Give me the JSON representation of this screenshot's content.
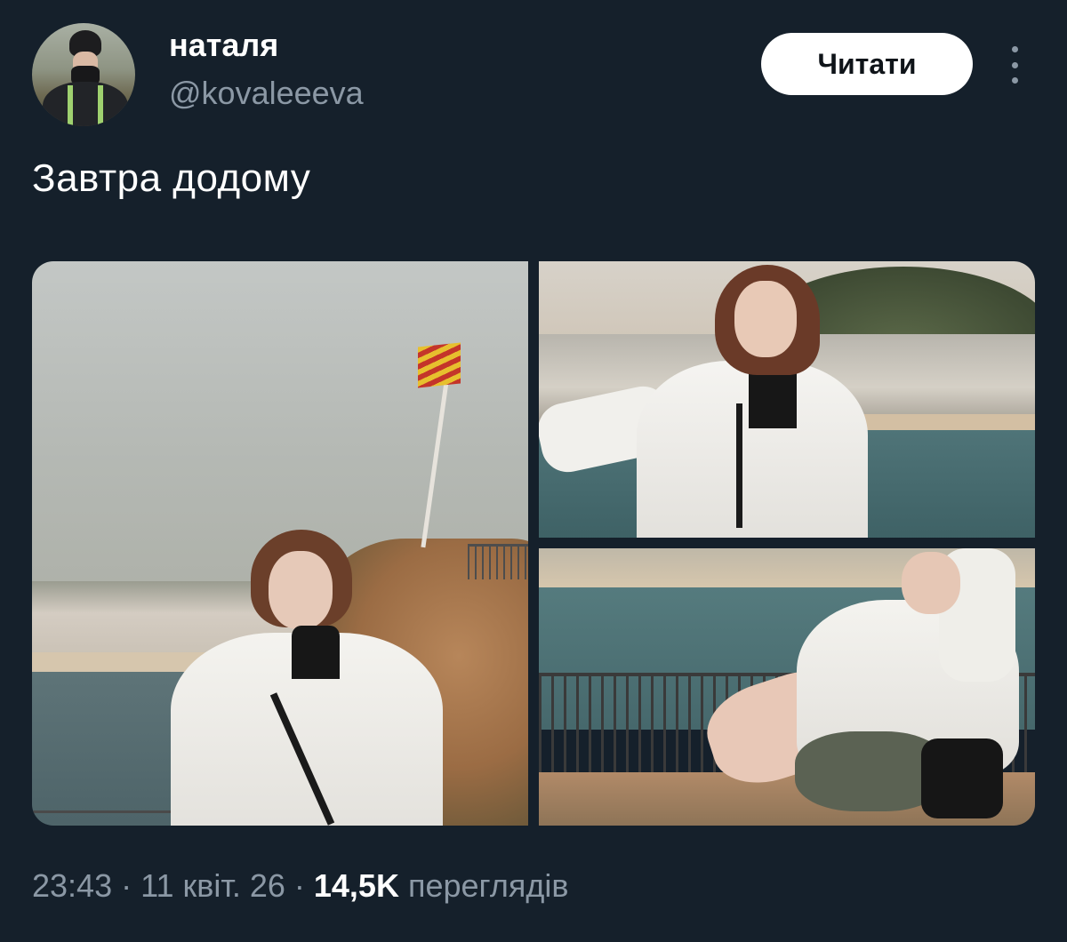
{
  "author": {
    "display_name": "наталя",
    "handle": "@kovaleeeva"
  },
  "actions": {
    "follow_label": "Читати",
    "more_icon": "more-vertical-icon"
  },
  "tweet": {
    "text": "Завтра додому",
    "media_count": 3
  },
  "meta": {
    "time": "23:43",
    "separator": " · ",
    "date": "11 квіт. 26",
    "views_count": "14,5K",
    "views_label": " переглядів"
  },
  "colors": {
    "background": "#15202b",
    "secondary_text": "#8b98a5",
    "primary_text": "#ffffff",
    "button_bg": "#ffffff"
  }
}
